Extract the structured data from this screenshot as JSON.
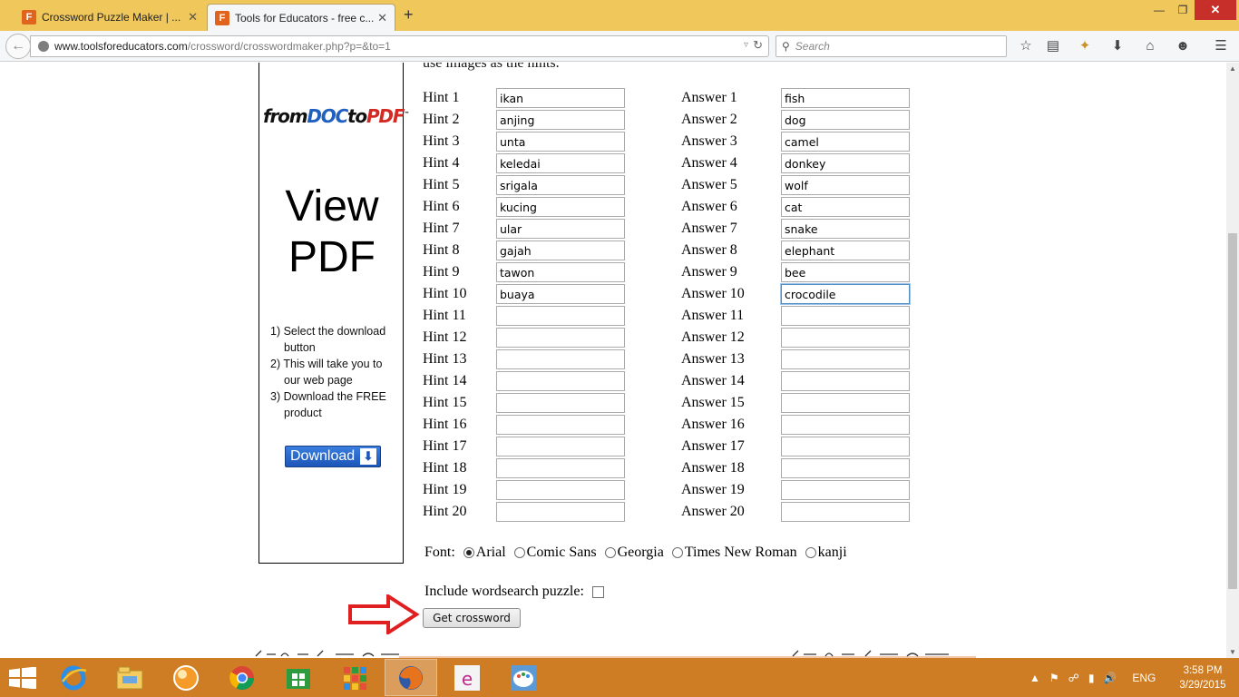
{
  "browser": {
    "tabs": [
      {
        "label": "Crossword Puzzle Maker | ...",
        "close": "✕",
        "favicon_letter": "F"
      },
      {
        "label": "Tools for Educators - free c...",
        "close": "✕",
        "favicon_letter": "F"
      }
    ],
    "new_tab": "+",
    "window_controls": {
      "minimize": "—",
      "maximize": "❐",
      "close": "✕"
    },
    "url_domain": "www.toolsforeducators.com",
    "url_path": "/crossword/crosswordmaker.php?p=&to=1",
    "search_placeholder": "Search",
    "toolbar_icons": [
      "bookmark-star-icon",
      "reading-list-icon",
      "extension-icon",
      "download-icon",
      "home-icon",
      "chat-icon",
      "menu-icon"
    ]
  },
  "ad": {
    "logo_from": "from",
    "logo_doc": "DOC",
    "logo_to": "to",
    "logo_pdf": "PDF",
    "logo_tm": "™",
    "view_line1": "View",
    "view_line2": "PDF",
    "steps": [
      "1) Select the download button",
      "2) This will take you to our web page",
      "3) Download the FREE product"
    ],
    "download_label": "Download",
    "download_arrow": "⬇"
  },
  "form": {
    "cut_off_text": "use images as the hints.",
    "hints": [
      {
        "label": "Hint 1",
        "value": "ikan"
      },
      {
        "label": "Hint 2",
        "value": "anjing"
      },
      {
        "label": "Hint 3",
        "value": "unta"
      },
      {
        "label": "Hint 4",
        "value": "keledai"
      },
      {
        "label": "Hint 5",
        "value": "srigala"
      },
      {
        "label": "Hint 6",
        "value": "kucing"
      },
      {
        "label": "Hint 7",
        "value": "ular"
      },
      {
        "label": "Hint 8",
        "value": "gajah"
      },
      {
        "label": "Hint 9",
        "value": "tawon"
      },
      {
        "label": "Hint 10",
        "value": "buaya"
      },
      {
        "label": "Hint 11",
        "value": ""
      },
      {
        "label": "Hint 12",
        "value": ""
      },
      {
        "label": "Hint 13",
        "value": ""
      },
      {
        "label": "Hint 14",
        "value": ""
      },
      {
        "label": "Hint 15",
        "value": ""
      },
      {
        "label": "Hint 16",
        "value": ""
      },
      {
        "label": "Hint 17",
        "value": ""
      },
      {
        "label": "Hint 18",
        "value": ""
      },
      {
        "label": "Hint 19",
        "value": ""
      },
      {
        "label": "Hint 20",
        "value": ""
      }
    ],
    "answers": [
      {
        "label": "Answer 1",
        "value": "fish"
      },
      {
        "label": "Answer 2",
        "value": "dog"
      },
      {
        "label": "Answer 3",
        "value": "camel"
      },
      {
        "label": "Answer 4",
        "value": "donkey"
      },
      {
        "label": "Answer 5",
        "value": "wolf"
      },
      {
        "label": "Answer 6",
        "value": "cat"
      },
      {
        "label": "Answer 7",
        "value": "snake"
      },
      {
        "label": "Answer 8",
        "value": "elephant"
      },
      {
        "label": "Answer 9",
        "value": "bee"
      },
      {
        "label": "Answer 10",
        "value": "crocodile"
      },
      {
        "label": "Answer 11",
        "value": ""
      },
      {
        "label": "Answer 12",
        "value": ""
      },
      {
        "label": "Answer 13",
        "value": ""
      },
      {
        "label": "Answer 14",
        "value": ""
      },
      {
        "label": "Answer 15",
        "value": ""
      },
      {
        "label": "Answer 16",
        "value": ""
      },
      {
        "label": "Answer 17",
        "value": ""
      },
      {
        "label": "Answer 18",
        "value": ""
      },
      {
        "label": "Answer 19",
        "value": ""
      },
      {
        "label": "Answer 20",
        "value": ""
      }
    ],
    "font_label": "Font:",
    "font_options": [
      {
        "label": "Arial",
        "selected": true
      },
      {
        "label": "Comic Sans",
        "selected": false
      },
      {
        "label": "Georgia",
        "selected": false
      },
      {
        "label": "Times New Roman",
        "selected": false
      },
      {
        "label": "kanji",
        "selected": false
      }
    ],
    "wordsearch_label": "Include wordsearch puzzle:",
    "wordsearch_checked": false,
    "submit_label": "Get crossword"
  },
  "taskbar": {
    "apps": [
      "internet-explorer-icon",
      "file-explorer-icon",
      "media-player-icon",
      "chrome-icon",
      "store-icon",
      "apps-grid-icon",
      "firefox-icon",
      "smartchem-icon",
      "paint-icon"
    ],
    "active_app": "firefox-icon",
    "language": "ENG",
    "time": "3:58 PM",
    "date": "3/29/2015"
  },
  "colors": {
    "titlebar": "#f0c75a",
    "taskbar": "#ce7d24",
    "focus_border": "#4d90c8",
    "annotation_arrow": "#e02020"
  }
}
